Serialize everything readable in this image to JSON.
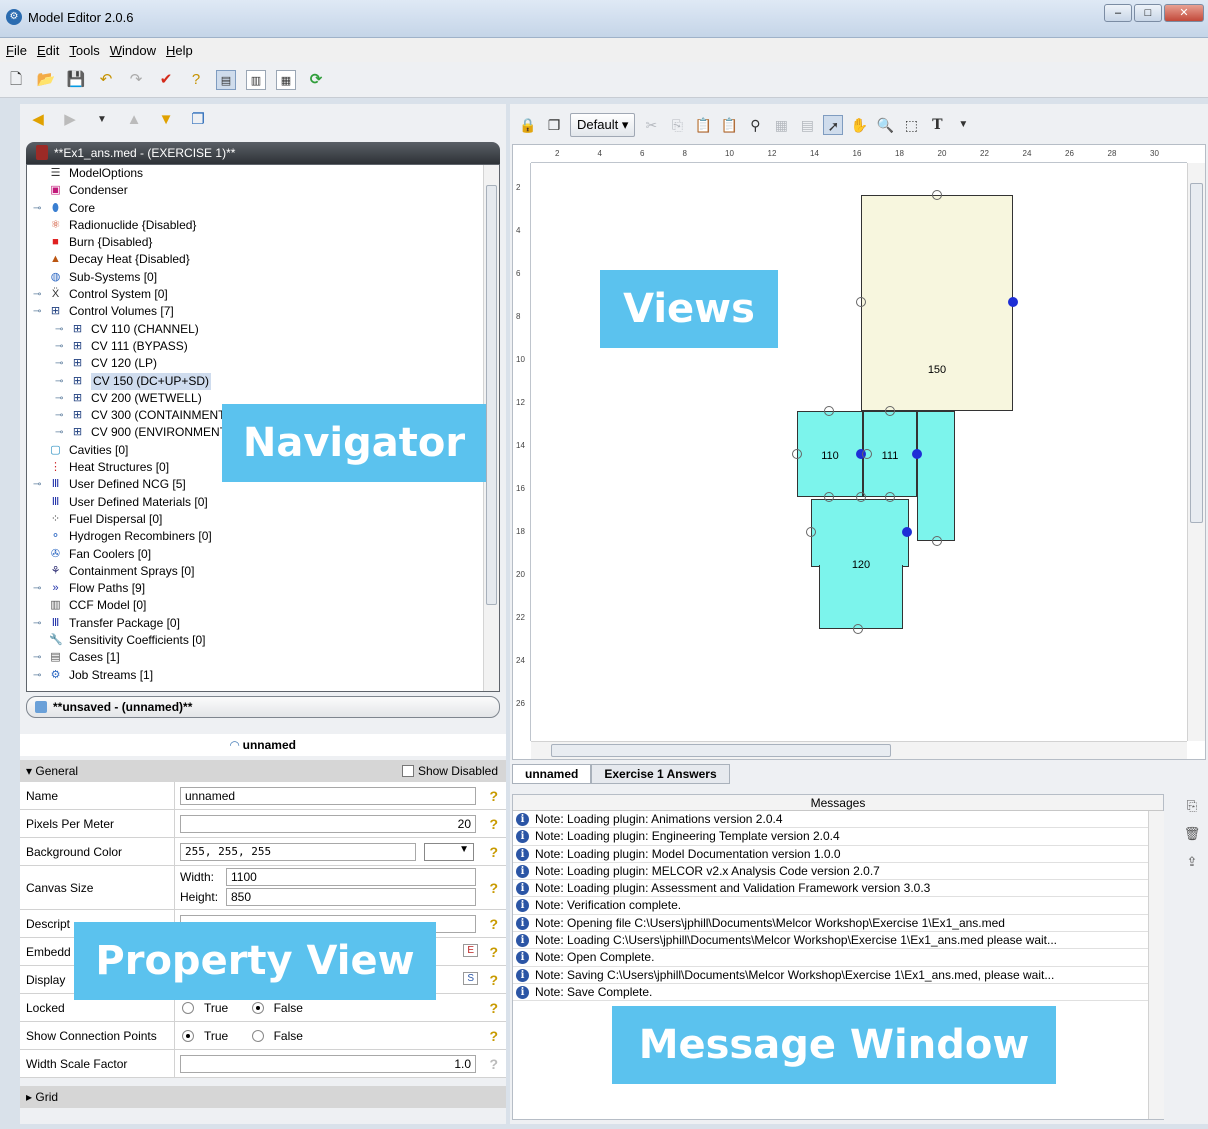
{
  "window": {
    "title": "Model Editor 2.0.6"
  },
  "menu": [
    "File",
    "Edit",
    "Tools",
    "Window",
    "Help"
  ],
  "navigator": {
    "header": "**Ex1_ans.med - (EXERCISE 1)**",
    "footer": "**unsaved - (unnamed)**",
    "items": [
      {
        "label": "ModelOptions",
        "indent": 0,
        "expander": false,
        "icon": "list-icon"
      },
      {
        "label": "Condenser",
        "indent": 0,
        "expander": false,
        "icon": "condenser-icon"
      },
      {
        "label": "Core",
        "indent": 0,
        "expander": true,
        "icon": "core-icon"
      },
      {
        "label": "Radionuclide {Disabled}",
        "indent": 0,
        "expander": false,
        "icon": "radionuclide-icon"
      },
      {
        "label": "Burn {Disabled}",
        "indent": 0,
        "expander": false,
        "icon": "burn-icon"
      },
      {
        "label": "Decay Heat {Disabled}",
        "indent": 0,
        "expander": false,
        "icon": "decay-heat-icon"
      },
      {
        "label": "Sub-Systems [0]",
        "indent": 0,
        "expander": false,
        "icon": "subsystems-icon"
      },
      {
        "label": "Control System [0]",
        "indent": 0,
        "expander": true,
        "icon": "xy-icon"
      },
      {
        "label": "Control Volumes [7]",
        "indent": 0,
        "expander": true,
        "icon": "grid-icon"
      },
      {
        "label": "CV 110 (CHANNEL)",
        "indent": 1,
        "expander": true,
        "icon": "grid-icon"
      },
      {
        "label": "CV 111 (BYPASS)",
        "indent": 1,
        "expander": true,
        "icon": "grid-icon"
      },
      {
        "label": "CV 120 (LP)",
        "indent": 1,
        "expander": true,
        "icon": "grid-icon"
      },
      {
        "label": "CV 150 (DC+UP+SD)",
        "indent": 1,
        "expander": true,
        "icon": "grid-icon",
        "selected": true
      },
      {
        "label": "CV 200 (WETWELL)",
        "indent": 1,
        "expander": true,
        "icon": "grid-icon"
      },
      {
        "label": "CV 300 (CONTAINMENT)",
        "indent": 1,
        "expander": true,
        "icon": "grid-icon"
      },
      {
        "label": "CV 900 (ENVIRONMENT)",
        "indent": 1,
        "expander": true,
        "icon": "grid-icon"
      },
      {
        "label": "Cavities [0]",
        "indent": 0,
        "expander": false,
        "icon": "cavity-icon"
      },
      {
        "label": "Heat Structures [0]",
        "indent": 0,
        "expander": false,
        "icon": "heat-structure-icon"
      },
      {
        "label": "User Defined NCG [5]",
        "indent": 0,
        "expander": true,
        "icon": "bars-icon"
      },
      {
        "label": "User Defined Materials [0]",
        "indent": 0,
        "expander": false,
        "icon": "bars-icon"
      },
      {
        "label": "Fuel Dispersal [0]",
        "indent": 0,
        "expander": false,
        "icon": "dots-icon"
      },
      {
        "label": "Hydrogen Recombiners [0]",
        "indent": 0,
        "expander": false,
        "icon": "molecule-icon"
      },
      {
        "label": "Fan Coolers [0]",
        "indent": 0,
        "expander": false,
        "icon": "fan-icon"
      },
      {
        "label": "Containment Sprays [0]",
        "indent": 0,
        "expander": false,
        "icon": "spray-icon"
      },
      {
        "label": "Flow Paths [9]",
        "indent": 0,
        "expander": true,
        "icon": "flow-icon"
      },
      {
        "label": "CCF Model [0]",
        "indent": 0,
        "expander": false,
        "icon": "ccf-icon"
      },
      {
        "label": "Transfer Package [0]",
        "indent": 0,
        "expander": true,
        "icon": "bars-icon"
      },
      {
        "label": "Sensitivity Coefficients [0]",
        "indent": 0,
        "expander": false,
        "icon": "wrench-icon"
      },
      {
        "label": "Cases [1]",
        "indent": 0,
        "expander": true,
        "icon": "cases-icon"
      },
      {
        "label": "Job Streams [1]",
        "indent": 0,
        "expander": true,
        "icon": "jobs-icon"
      }
    ]
  },
  "property_view": {
    "title": "unnamed",
    "section_general": "General",
    "show_disabled": "Show Disabled",
    "section_grid": "Grid",
    "rows": {
      "name": {
        "label": "Name",
        "value": "unnamed"
      },
      "ppm": {
        "label": "Pixels Per Meter",
        "value": "20"
      },
      "bg": {
        "label": "Background Color",
        "value": "255, 255, 255"
      },
      "canvas": {
        "label": "Canvas Size",
        "width_label": "Width:",
        "width": "1100",
        "height_label": "Height:",
        "height": "850"
      },
      "desc": {
        "label": "Descript"
      },
      "embed": {
        "label": "Embedd"
      },
      "display": {
        "label": "Display"
      },
      "locked": {
        "label": "Locked",
        "true": "True",
        "false": "False"
      },
      "showcp": {
        "label": "Show Connection Points",
        "true": "True",
        "false": "False"
      },
      "wsf": {
        "label": "Width Scale Factor",
        "value": "1.0"
      }
    }
  },
  "views": {
    "dropdown": "Default",
    "ruler_h": [
      "2",
      "4",
      "6",
      "8",
      "10",
      "12",
      "14",
      "16",
      "18",
      "20",
      "22",
      "24",
      "26",
      "28",
      "30"
    ],
    "ruler_v": [
      "2",
      "4",
      "6",
      "8",
      "10",
      "12",
      "14",
      "16",
      "18",
      "20",
      "22",
      "24",
      "26"
    ],
    "cvs": [
      "150",
      "110",
      "111",
      "120"
    ]
  },
  "tabs": [
    "unnamed",
    "Exercise 1 Answers"
  ],
  "messages": {
    "header": "Messages",
    "rows": [
      "Note: Loading plugin: Animations version 2.0.4",
      "Note: Loading plugin: Engineering Template version 2.0.4",
      "Note: Loading plugin: Model Documentation version 1.0.0",
      "Note: Loading plugin: MELCOR v2.x Analysis Code version 2.0.7",
      "Note: Loading plugin: Assessment and Validation Framework version 3.0.3",
      "Note: Verification complete.",
      "Note: Opening file C:\\Users\\jphill\\Documents\\Melcor Workshop\\Exercise 1\\Ex1_ans.med",
      "Note: Loading C:\\Users\\jphill\\Documents\\Melcor Workshop\\Exercise 1\\Ex1_ans.med please wait...",
      "Note: Open Complete.",
      "Note: Saving C:\\Users\\jphill\\Documents\\Melcor Workshop\\Exercise 1\\Ex1_ans.med, please wait...",
      "Note: Save Complete."
    ]
  },
  "overlays": {
    "navigator": "Navigator",
    "views": "Views",
    "property_view": "Property View",
    "message_window": "Message Window"
  },
  "colors": {
    "overlay": "#5bc2ee",
    "cv_top": "#f7f6de",
    "cv": "#7cf4ec",
    "connection": "#1e2fd6"
  }
}
